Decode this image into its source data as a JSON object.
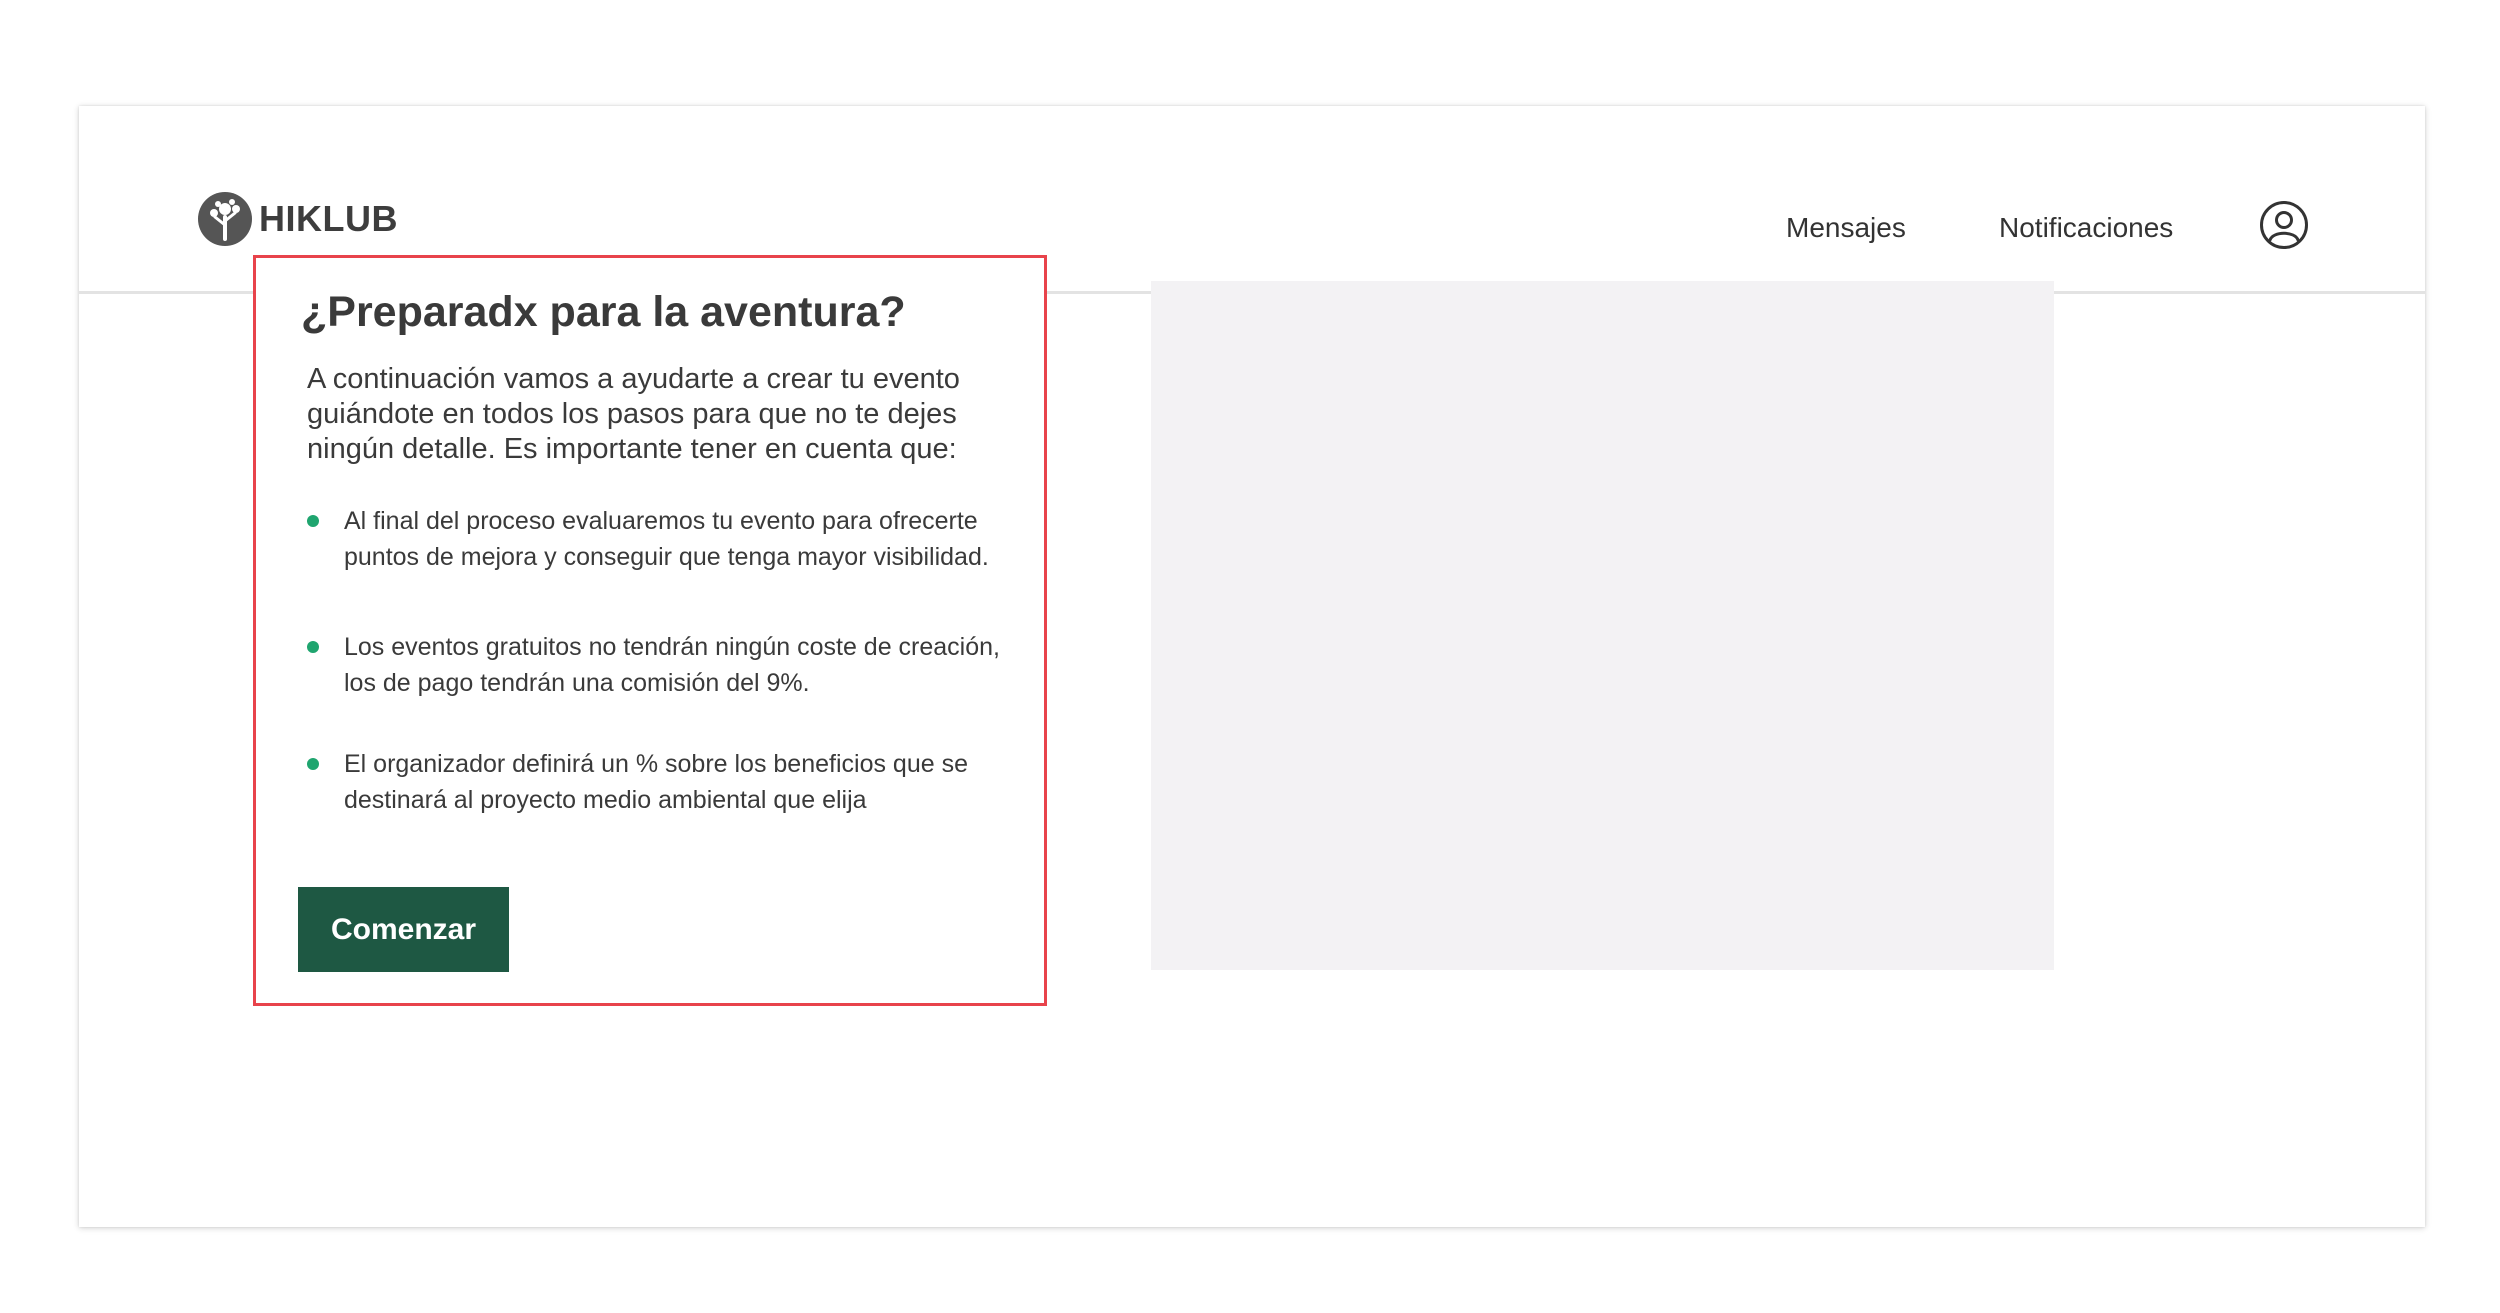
{
  "brand": {
    "name": "HIKLUB",
    "logo_icon": "tree-leaf-icon",
    "logo_color": "#555555"
  },
  "nav": {
    "messages": "Mensajes",
    "notifications": "Notificaciones",
    "user_icon": "user-circle-icon"
  },
  "card": {
    "title": "¿Preparadx para la aventura?",
    "intro": "A continuación vamos a ayudarte a crear tu evento guiándote en todos los pasos para que no te dejes ningún detalle. Es importante tener en cuenta que:",
    "bullets": [
      "Al final del proceso evaluaremos tu evento para ofrecerte puntos de mejora y conseguir que tenga mayor visibilidad.",
      "Los eventos gratuitos no tendrán ningún coste de creación,  los de pago tendrán una comisión del 9%.",
      "El organizador definirá un % sobre los beneficios que se destinará al proyecto medio ambiental que elija"
    ],
    "button_label": "Comenzar"
  },
  "colors": {
    "accent_green": "#1e5843",
    "bullet_green": "#1fa56f",
    "highlight_border": "#e8434b",
    "placeholder_bg": "#f3f2f4"
  }
}
